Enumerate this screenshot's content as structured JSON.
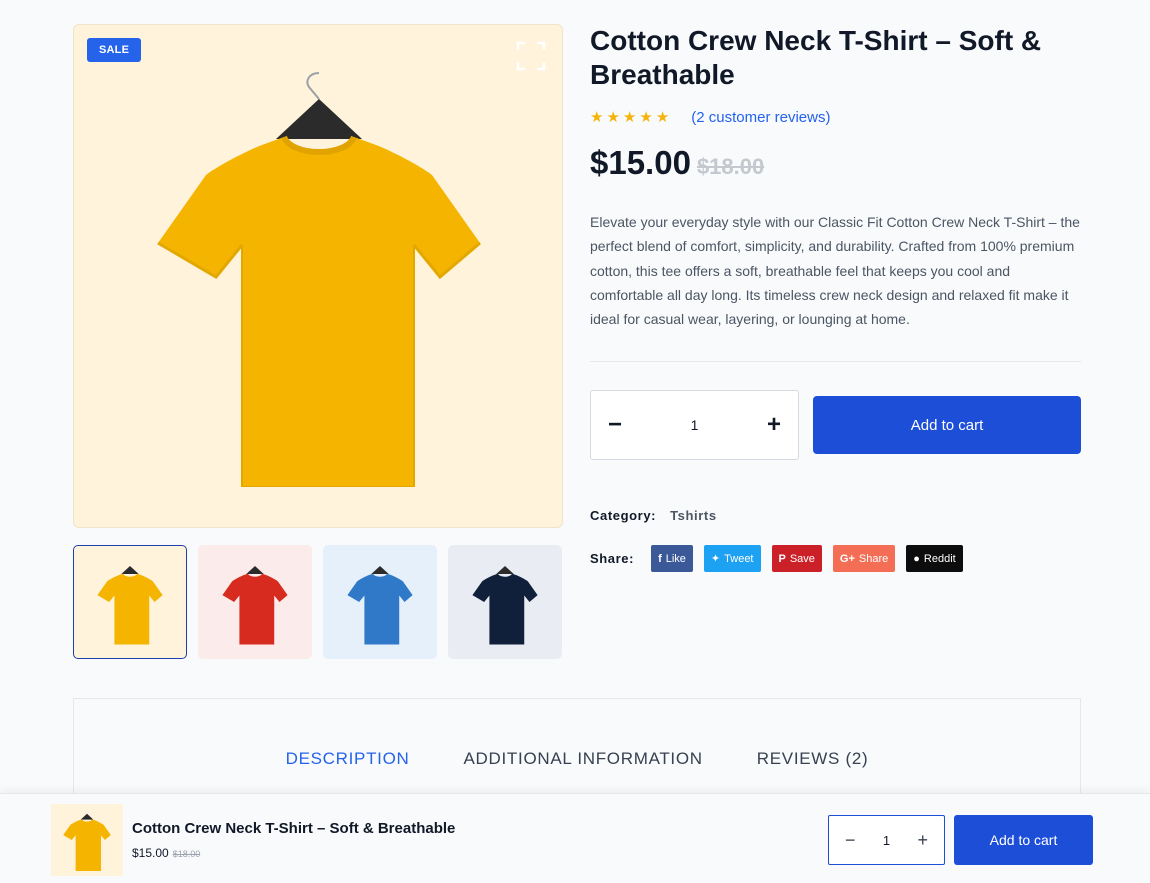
{
  "product": {
    "sale_badge": "SALE",
    "title": "Cotton Crew Neck T-Shirt – Soft & Breathable",
    "rating": 5,
    "reviews_link": "(2 customer reviews)",
    "price_current": "$15.00",
    "price_original": "$18.00",
    "description": "Elevate your everyday style with our Classic Fit Cotton Crew Neck T-Shirt – the perfect blend of comfort, simplicity, and durability. Crafted from 100% premium cotton, this tee offers a soft, breathable feel that keeps you cool and comfortable all day long. Its timeless crew neck design and relaxed fit make it ideal for casual wear, layering, or lounging at home.",
    "quantity": "1",
    "minus": "−",
    "plus": "+",
    "add_to_cart": "Add to cart",
    "category_label": "Category:",
    "category_value": "Tshirts",
    "share_label": "Share:"
  },
  "icons": {
    "expand": "expand-icon",
    "star": "star-icon"
  },
  "thumbnails": [
    {
      "name": "thumbnail-yellow",
      "color": "#f5b400",
      "bg": "#fff3dc",
      "active": true
    },
    {
      "name": "thumbnail-red",
      "color": "#d62b1e",
      "bg": "#fcebeb",
      "active": false
    },
    {
      "name": "thumbnail-blue",
      "color": "#2f79c8",
      "bg": "#e6f0fa",
      "active": false
    },
    {
      "name": "thumbnail-navy",
      "color": "#10203a",
      "bg": "#e9edf3",
      "active": false
    }
  ],
  "share_buttons": [
    {
      "icon": "f",
      "label": "Like",
      "color": "#3b5998",
      "name": "share-facebook-button"
    },
    {
      "icon": "✦",
      "label": "Tweet",
      "color": "#1da1f2",
      "name": "share-twitter-button"
    },
    {
      "icon": "P",
      "label": "Save",
      "color": "#cb2027",
      "name": "share-pinterest-button"
    },
    {
      "icon": "G+",
      "label": "Share",
      "color": "#f46e55",
      "name": "share-google-button"
    },
    {
      "icon": "●",
      "label": "Reddit",
      "color": "#0d0d0d",
      "name": "share-reddit-button"
    }
  ],
  "tabs": [
    {
      "label": "DESCRIPTION",
      "active": true
    },
    {
      "label": "ADDITIONAL INFORMATION",
      "active": false
    },
    {
      "label": "REVIEWS (2)",
      "active": false
    }
  ],
  "sticky": {
    "title": "Cotton Crew Neck T-Shirt – Soft & Breathable",
    "price_current": "$15.00",
    "price_original": "$18.00",
    "quantity": "1",
    "minus": "−",
    "plus": "+",
    "add_to_cart": "Add to cart"
  },
  "colors": {
    "accent": "#1d4ed8",
    "star": "#f5b40b",
    "shirt_main": "#f5b400"
  }
}
